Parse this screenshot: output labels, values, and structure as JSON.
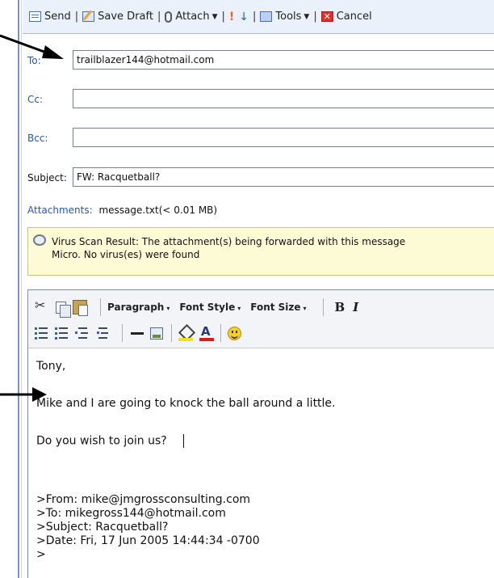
{
  "toolbar": {
    "send": "Send",
    "save_draft": "Save Draft",
    "attach": "Attach",
    "tools": "Tools",
    "cancel": "Cancel",
    "separator": "|",
    "high_priority": "!",
    "low_priority": "↓"
  },
  "header": {
    "to_label": "To:",
    "to_value": "trailblazer144@hotmail.com",
    "cc_label": "Cc:",
    "cc_value": "",
    "bcc_label": "Bcc:",
    "bcc_value": "",
    "subject_label": "Subject:",
    "subject_value": "FW: Racquetball?"
  },
  "attachments": {
    "label": "Attachments:",
    "file": "message.txt(< 0.01 MB)"
  },
  "virus_scan": {
    "line1": "Virus Scan Result: The attachment(s) being forwarded with this message",
    "line2": "Micro. No virus(es) were found"
  },
  "editor_toolbar": {
    "paragraph": "Paragraph",
    "font_style": "Font Style",
    "font_size": "Font Size",
    "bold": "B",
    "italic": "I",
    "dropdown_caret": "▾"
  },
  "body": {
    "greeting": "Tony,",
    "line1": "Mike and I are going to knock the ball around a little.",
    "line2": "Do you wish to join us?",
    "quoted": [
      ">From: mike@jmgrossconsulting.com",
      ">To: mikegross144@hotmail.com",
      ">Subject: Racquetball?",
      ">Date: Fri, 17 Jun 2005 14:44:34 -0700",
      ">"
    ]
  }
}
